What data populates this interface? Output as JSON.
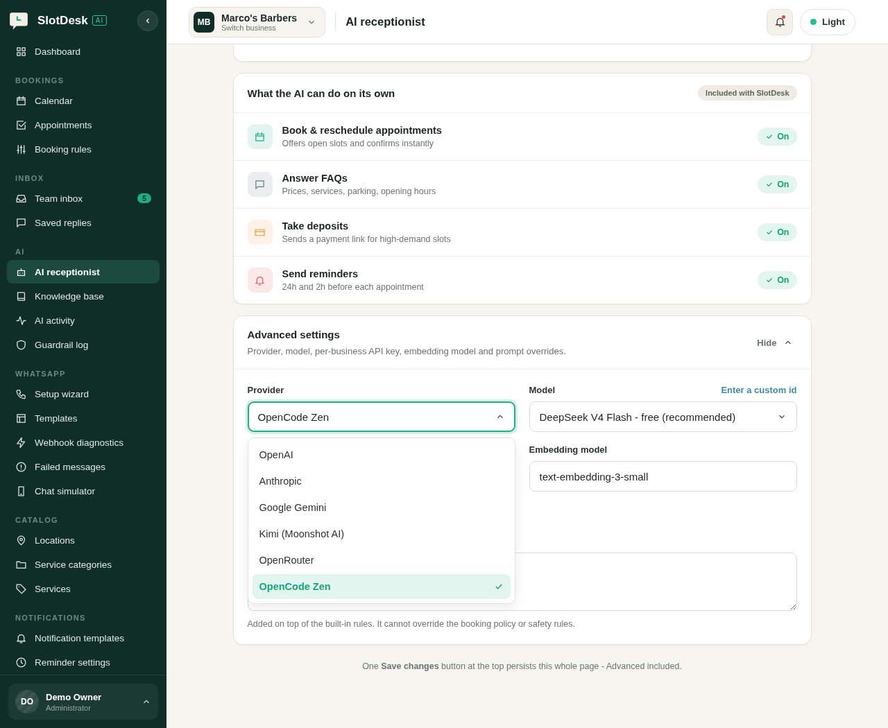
{
  "sidebar": {
    "brand": "SlotDesk",
    "brand_badge": "AI",
    "sections": [
      {
        "items": [
          {
            "label": "Dashboard",
            "selected": false
          }
        ]
      },
      {
        "heading": "BOOKINGS",
        "items": [
          {
            "label": "Calendar",
            "selected": false
          },
          {
            "label": "Appointments",
            "selected": false
          },
          {
            "label": "Booking rules",
            "selected": false
          }
        ]
      },
      {
        "heading": "INBOX",
        "items": [
          {
            "label": "Team inbox",
            "selected": false,
            "count": "5"
          },
          {
            "label": "Saved replies",
            "selected": false
          }
        ]
      },
      {
        "heading": "AI",
        "items": [
          {
            "label": "AI receptionist",
            "selected": true
          },
          {
            "label": "Knowledge base",
            "selected": false
          },
          {
            "label": "AI activity",
            "selected": false
          },
          {
            "label": "Guardrail log",
            "selected": false
          }
        ]
      },
      {
        "heading": "WHATSAPP",
        "items": [
          {
            "label": "Setup wizard",
            "selected": false
          },
          {
            "label": "Templates",
            "selected": false
          },
          {
            "label": "Webhook diagnostics",
            "selected": false
          },
          {
            "label": "Failed messages",
            "selected": false
          },
          {
            "label": "Chat simulator",
            "selected": false
          }
        ]
      },
      {
        "heading": "CATALOG",
        "items": [
          {
            "label": "Locations",
            "selected": false
          },
          {
            "label": "Service categories",
            "selected": false
          },
          {
            "label": "Services",
            "selected": false
          }
        ]
      },
      {
        "heading": "NOTIFICATIONS",
        "items": [
          {
            "label": "Notification templates",
            "selected": false
          },
          {
            "label": "Reminder settings",
            "selected": false
          }
        ]
      }
    ],
    "user": {
      "initials": "DO",
      "name": "Demo Owner",
      "role": "Administrator"
    }
  },
  "header": {
    "business": {
      "initials": "MB",
      "name": "Marco's Barbers",
      "subtitle": "Switch business"
    },
    "page_title": "AI receptionist",
    "notification_unread": true,
    "theme": "Light"
  },
  "capabilities": {
    "title": "What the AI can do on its own",
    "badge": "Included with SlotDesk",
    "items": [
      {
        "title": "Book & reschedule appointments",
        "description": "Offers open slots and confirms instantly",
        "color": "#1fae84",
        "on": true,
        "status": "On"
      },
      {
        "title": "Answer FAQs",
        "description": "Prices, services, parking, opening hours",
        "color": "#5f7d86",
        "on": true,
        "status": "On"
      },
      {
        "title": "Take deposits",
        "description": "Sends a payment link for high-demand slots",
        "color": "#e59a3c",
        "on": true,
        "status": "On"
      },
      {
        "title": "Send reminders",
        "description": "24h and 2h before each appointment",
        "color": "#e0565b",
        "on": true,
        "status": "On"
      }
    ]
  },
  "advanced": {
    "title": "Advanced settings",
    "description": "Provider, model, per-business API key, embedding model and prompt overrides.",
    "toggle": "Hide",
    "expanded": true,
    "provider": {
      "label": "Provider",
      "value": "OpenCode Zen",
      "open": true,
      "options": [
        {
          "label": "OpenAI",
          "selected": false
        },
        {
          "label": "Anthropic",
          "selected": false
        },
        {
          "label": "Google Gemini",
          "selected": false
        },
        {
          "label": "Kimi (Moonshot AI)",
          "selected": false
        },
        {
          "label": "OpenRouter",
          "selected": false
        },
        {
          "label": "OpenCode Zen",
          "selected": true
        }
      ]
    },
    "model": {
      "label": "Model",
      "link": "Enter a custom id",
      "value": "DeepSeek V4 Flash - free (recommended)"
    },
    "embedding": {
      "label": "Embedding model",
      "value": "text-embedding-3-small"
    },
    "prompt_hint": "Added on top of the built-in rules. It cannot override the booking policy or safety rules."
  },
  "footer_note": "One **Save changes** button at the top persists this whole page - Advanced included."
}
